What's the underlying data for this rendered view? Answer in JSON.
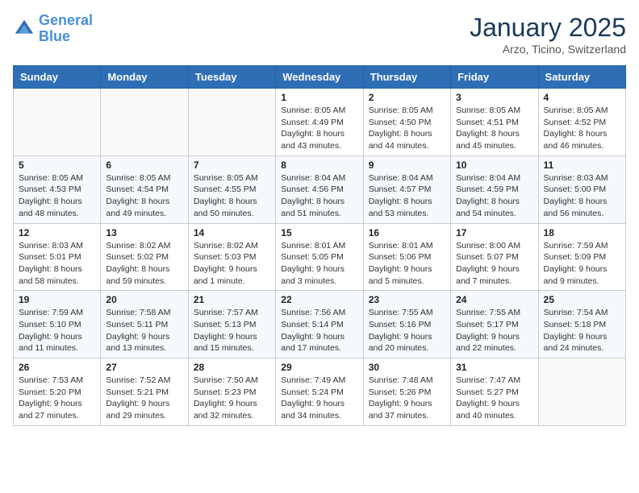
{
  "logo": {
    "line1": "General",
    "line2": "Blue"
  },
  "title": "January 2025",
  "subtitle": "Arzo, Ticino, Switzerland",
  "weekdays": [
    "Sunday",
    "Monday",
    "Tuesday",
    "Wednesday",
    "Thursday",
    "Friday",
    "Saturday"
  ],
  "weeks": [
    [
      {
        "day": "",
        "info": ""
      },
      {
        "day": "",
        "info": ""
      },
      {
        "day": "",
        "info": ""
      },
      {
        "day": "1",
        "info": "Sunrise: 8:05 AM\nSunset: 4:49 PM\nDaylight: 8 hours and 43 minutes."
      },
      {
        "day": "2",
        "info": "Sunrise: 8:05 AM\nSunset: 4:50 PM\nDaylight: 8 hours and 44 minutes."
      },
      {
        "day": "3",
        "info": "Sunrise: 8:05 AM\nSunset: 4:51 PM\nDaylight: 8 hours and 45 minutes."
      },
      {
        "day": "4",
        "info": "Sunrise: 8:05 AM\nSunset: 4:52 PM\nDaylight: 8 hours and 46 minutes."
      }
    ],
    [
      {
        "day": "5",
        "info": "Sunrise: 8:05 AM\nSunset: 4:53 PM\nDaylight: 8 hours and 48 minutes."
      },
      {
        "day": "6",
        "info": "Sunrise: 8:05 AM\nSunset: 4:54 PM\nDaylight: 8 hours and 49 minutes."
      },
      {
        "day": "7",
        "info": "Sunrise: 8:05 AM\nSunset: 4:55 PM\nDaylight: 8 hours and 50 minutes."
      },
      {
        "day": "8",
        "info": "Sunrise: 8:04 AM\nSunset: 4:56 PM\nDaylight: 8 hours and 51 minutes."
      },
      {
        "day": "9",
        "info": "Sunrise: 8:04 AM\nSunset: 4:57 PM\nDaylight: 8 hours and 53 minutes."
      },
      {
        "day": "10",
        "info": "Sunrise: 8:04 AM\nSunset: 4:59 PM\nDaylight: 8 hours and 54 minutes."
      },
      {
        "day": "11",
        "info": "Sunrise: 8:03 AM\nSunset: 5:00 PM\nDaylight: 8 hours and 56 minutes."
      }
    ],
    [
      {
        "day": "12",
        "info": "Sunrise: 8:03 AM\nSunset: 5:01 PM\nDaylight: 8 hours and 58 minutes."
      },
      {
        "day": "13",
        "info": "Sunrise: 8:02 AM\nSunset: 5:02 PM\nDaylight: 8 hours and 59 minutes."
      },
      {
        "day": "14",
        "info": "Sunrise: 8:02 AM\nSunset: 5:03 PM\nDaylight: 9 hours and 1 minute."
      },
      {
        "day": "15",
        "info": "Sunrise: 8:01 AM\nSunset: 5:05 PM\nDaylight: 9 hours and 3 minutes."
      },
      {
        "day": "16",
        "info": "Sunrise: 8:01 AM\nSunset: 5:06 PM\nDaylight: 9 hours and 5 minutes."
      },
      {
        "day": "17",
        "info": "Sunrise: 8:00 AM\nSunset: 5:07 PM\nDaylight: 9 hours and 7 minutes."
      },
      {
        "day": "18",
        "info": "Sunrise: 7:59 AM\nSunset: 5:09 PM\nDaylight: 9 hours and 9 minutes."
      }
    ],
    [
      {
        "day": "19",
        "info": "Sunrise: 7:59 AM\nSunset: 5:10 PM\nDaylight: 9 hours and 11 minutes."
      },
      {
        "day": "20",
        "info": "Sunrise: 7:58 AM\nSunset: 5:11 PM\nDaylight: 9 hours and 13 minutes."
      },
      {
        "day": "21",
        "info": "Sunrise: 7:57 AM\nSunset: 5:13 PM\nDaylight: 9 hours and 15 minutes."
      },
      {
        "day": "22",
        "info": "Sunrise: 7:56 AM\nSunset: 5:14 PM\nDaylight: 9 hours and 17 minutes."
      },
      {
        "day": "23",
        "info": "Sunrise: 7:55 AM\nSunset: 5:16 PM\nDaylight: 9 hours and 20 minutes."
      },
      {
        "day": "24",
        "info": "Sunrise: 7:55 AM\nSunset: 5:17 PM\nDaylight: 9 hours and 22 minutes."
      },
      {
        "day": "25",
        "info": "Sunrise: 7:54 AM\nSunset: 5:18 PM\nDaylight: 9 hours and 24 minutes."
      }
    ],
    [
      {
        "day": "26",
        "info": "Sunrise: 7:53 AM\nSunset: 5:20 PM\nDaylight: 9 hours and 27 minutes."
      },
      {
        "day": "27",
        "info": "Sunrise: 7:52 AM\nSunset: 5:21 PM\nDaylight: 9 hours and 29 minutes."
      },
      {
        "day": "28",
        "info": "Sunrise: 7:50 AM\nSunset: 5:23 PM\nDaylight: 9 hours and 32 minutes."
      },
      {
        "day": "29",
        "info": "Sunrise: 7:49 AM\nSunset: 5:24 PM\nDaylight: 9 hours and 34 minutes."
      },
      {
        "day": "30",
        "info": "Sunrise: 7:48 AM\nSunset: 5:26 PM\nDaylight: 9 hours and 37 minutes."
      },
      {
        "day": "31",
        "info": "Sunrise: 7:47 AM\nSunset: 5:27 PM\nDaylight: 9 hours and 40 minutes."
      },
      {
        "day": "",
        "info": ""
      }
    ]
  ]
}
